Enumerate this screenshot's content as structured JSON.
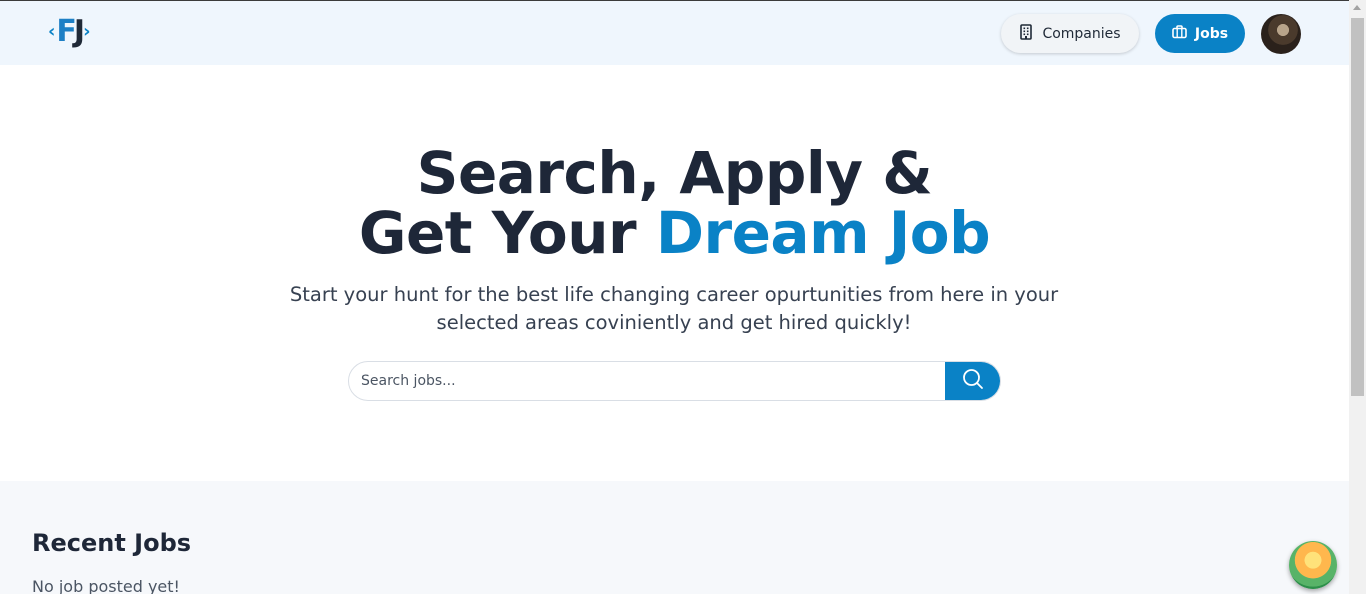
{
  "header": {
    "logo": {
      "left": "‹",
      "letters_f": "F",
      "letters_j": "J",
      "right": "›"
    },
    "nav": {
      "companies_label": "Companies",
      "jobs_label": "Jobs"
    }
  },
  "hero": {
    "headline_line1": "Search, Apply &",
    "headline_line2_prefix": "Get Your ",
    "headline_line2_accent": "Dream Job",
    "subtext": "Start your hunt for the best life changing career opurtunities from here in your selected areas coviniently and get hired quickly!",
    "search": {
      "placeholder": "Search jobs...",
      "value": ""
    }
  },
  "recent": {
    "title": "Recent Jobs",
    "empty_message": "No job posted yet!"
  },
  "colors": {
    "accent": "#0a82c6",
    "heading": "#1e2738",
    "header_bg": "#eff6fd",
    "section_bg": "#f6f8fb"
  },
  "icons": {
    "companies": "building-icon",
    "jobs": "briefcase-icon",
    "search": "search-icon"
  }
}
